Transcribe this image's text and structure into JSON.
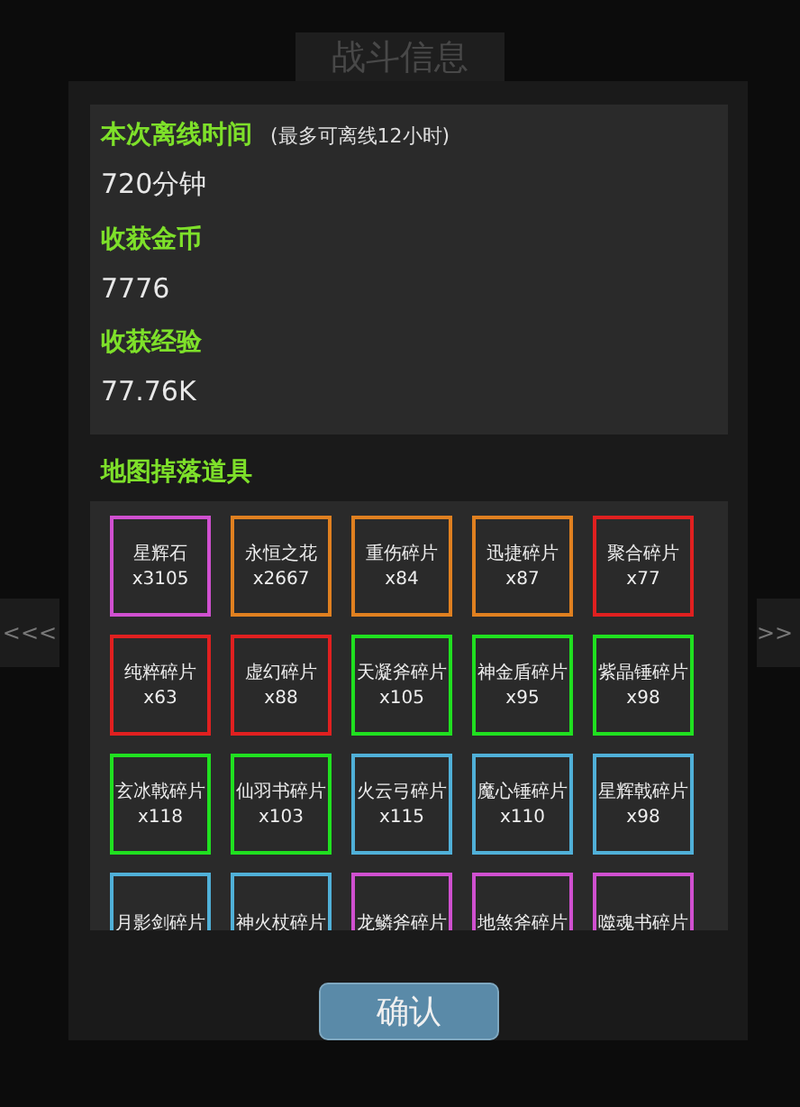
{
  "title_tab": "战斗信息",
  "side_buttons": {
    "left": "<<<",
    "right": ">>"
  },
  "summary": [
    {
      "label": "本次离线时间",
      "note": "(最多可离线12小时)",
      "value": "720分钟"
    },
    {
      "label": "收获金币",
      "value": "7776"
    },
    {
      "label": "收获经验",
      "value": "77.76K"
    }
  ],
  "drops": {
    "title": "地图掉落道具",
    "items": [
      {
        "name": "星辉石",
        "count": "x3105",
        "color": "#d050d0"
      },
      {
        "name": "永恒之花",
        "count": "x2667",
        "color": "#e08020"
      },
      {
        "name": "重伤碎片",
        "count": "x84",
        "color": "#e08020"
      },
      {
        "name": "迅捷碎片",
        "count": "x87",
        "color": "#e08020"
      },
      {
        "name": "聚合碎片",
        "count": "x77",
        "color": "#e02020"
      },
      {
        "name": "纯粹碎片",
        "count": "x63",
        "color": "#e02020"
      },
      {
        "name": "虚幻碎片",
        "count": "x88",
        "color": "#e02020"
      },
      {
        "name": "天凝斧碎片",
        "count": "x105",
        "color": "#20e020"
      },
      {
        "name": "神金盾碎片",
        "count": "x95",
        "color": "#20e020"
      },
      {
        "name": "紫晶锤碎片",
        "count": "x98",
        "color": "#20e020"
      },
      {
        "name": "玄冰戟碎片",
        "count": "x118",
        "color": "#20e020"
      },
      {
        "name": "仙羽书碎片",
        "count": "x103",
        "color": "#20e020"
      },
      {
        "name": "火云弓碎片",
        "count": "x115",
        "color": "#50b0d8"
      },
      {
        "name": "魔心锤碎片",
        "count": "x110",
        "color": "#50b0d8"
      },
      {
        "name": "星辉戟碎片",
        "count": "x98",
        "color": "#50b0d8"
      },
      {
        "name": "月影剑碎片",
        "color": "#50b0d8"
      },
      {
        "name": "神火杖碎片",
        "color": "#50b0d8"
      },
      {
        "name": "龙鳞斧碎片",
        "color": "#d050d0"
      },
      {
        "name": "地煞斧碎片",
        "color": "#d050d0"
      },
      {
        "name": "噬魂书碎片",
        "color": "#d050d0"
      }
    ]
  },
  "confirm_button": "确认"
}
